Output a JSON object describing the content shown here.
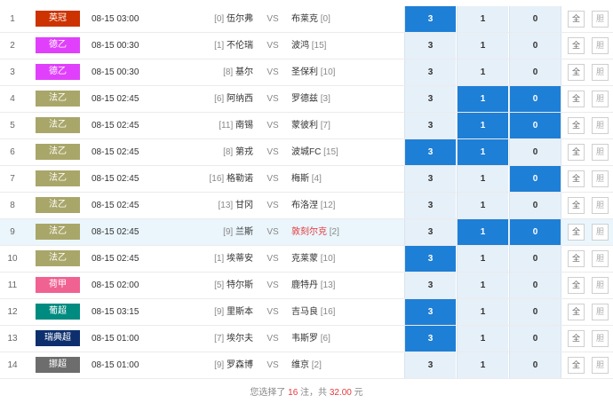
{
  "colors": {
    "selected_odds_bg": "#1e7fd6",
    "unselected_odds_bg": "#e6f0f9",
    "highlight_row_bg": "#eaf6fc",
    "accent_red": "#e4393c"
  },
  "rows": [
    {
      "idx": "1",
      "league": "英冠",
      "league_color": "#cc3300",
      "time": "08-15 03:00",
      "home_rank": "[0]",
      "home": "伍尔弗",
      "vs": "VS",
      "away": "布莱克",
      "away_rank": "[0]",
      "odds": [
        "3",
        "1",
        "0"
      ],
      "sel": [
        true,
        false,
        false
      ],
      "away_red": false,
      "hl": false,
      "all": "全",
      "clear": "胆"
    },
    {
      "idx": "2",
      "league": "德乙",
      "league_color": "#e040fb",
      "time": "08-15 00:30",
      "home_rank": "[1]",
      "home": "不伦瑞",
      "vs": "VS",
      "away": "波鸿",
      "away_rank": "[15]",
      "odds": [
        "3",
        "1",
        "0"
      ],
      "sel": [
        false,
        false,
        false
      ],
      "away_red": false,
      "hl": false,
      "all": "全",
      "clear": "胆"
    },
    {
      "idx": "3",
      "league": "德乙",
      "league_color": "#e040fb",
      "time": "08-15 00:30",
      "home_rank": "[8]",
      "home": "基尔",
      "vs": "VS",
      "away": "圣保利",
      "away_rank": "[10]",
      "odds": [
        "3",
        "1",
        "0"
      ],
      "sel": [
        false,
        false,
        false
      ],
      "away_red": false,
      "hl": false,
      "all": "全",
      "clear": "胆"
    },
    {
      "idx": "4",
      "league": "法乙",
      "league_color": "#a9a66a",
      "time": "08-15 02:45",
      "home_rank": "[6]",
      "home": "阿纳西",
      "vs": "VS",
      "away": "罗德兹",
      "away_rank": "[3]",
      "odds": [
        "3",
        "1",
        "0"
      ],
      "sel": [
        false,
        true,
        true
      ],
      "away_red": false,
      "hl": false,
      "all": "全",
      "clear": "胆"
    },
    {
      "idx": "5",
      "league": "法乙",
      "league_color": "#a9a66a",
      "time": "08-15 02:45",
      "home_rank": "[11]",
      "home": "南锡",
      "vs": "VS",
      "away": "蒙彼利",
      "away_rank": "[7]",
      "odds": [
        "3",
        "1",
        "0"
      ],
      "sel": [
        false,
        true,
        true
      ],
      "away_red": false,
      "hl": false,
      "all": "全",
      "clear": "胆"
    },
    {
      "idx": "6",
      "league": "法乙",
      "league_color": "#a9a66a",
      "time": "08-15 02:45",
      "home_rank": "[8]",
      "home": "第戎",
      "vs": "VS",
      "away": "波城FC",
      "away_rank": "[15]",
      "odds": [
        "3",
        "1",
        "0"
      ],
      "sel": [
        true,
        true,
        false
      ],
      "away_red": false,
      "hl": false,
      "all": "全",
      "clear": "胆"
    },
    {
      "idx": "7",
      "league": "法乙",
      "league_color": "#a9a66a",
      "time": "08-15 02:45",
      "home_rank": "[16]",
      "home": "格勒诺",
      "vs": "VS",
      "away": "梅斯",
      "away_rank": "[4]",
      "odds": [
        "3",
        "1",
        "0"
      ],
      "sel": [
        false,
        false,
        true
      ],
      "away_red": false,
      "hl": false,
      "all": "全",
      "clear": "胆"
    },
    {
      "idx": "8",
      "league": "法乙",
      "league_color": "#a9a66a",
      "time": "08-15 02:45",
      "home_rank": "[13]",
      "home": "甘冈",
      "vs": "VS",
      "away": "布洛涅",
      "away_rank": "[12]",
      "odds": [
        "3",
        "1",
        "0"
      ],
      "sel": [
        false,
        false,
        false
      ],
      "away_red": false,
      "hl": false,
      "all": "全",
      "clear": "胆"
    },
    {
      "idx": "9",
      "league": "法乙",
      "league_color": "#a9a66a",
      "time": "08-15 02:45",
      "home_rank": "[9]",
      "home": "兰斯",
      "vs": "VS",
      "away": "敦刻尔克",
      "away_rank": "[2]",
      "odds": [
        "3",
        "1",
        "0"
      ],
      "sel": [
        false,
        true,
        true
      ],
      "away_red": true,
      "hl": true,
      "all": "全",
      "clear": "胆"
    },
    {
      "idx": "10",
      "league": "法乙",
      "league_color": "#a9a66a",
      "time": "08-15 02:45",
      "home_rank": "[1]",
      "home": "埃蒂安",
      "vs": "VS",
      "away": "克莱蒙",
      "away_rank": "[10]",
      "odds": [
        "3",
        "1",
        "0"
      ],
      "sel": [
        true,
        false,
        false
      ],
      "away_red": false,
      "hl": false,
      "all": "全",
      "clear": "胆"
    },
    {
      "idx": "11",
      "league": "荷甲",
      "league_color": "#f06292",
      "time": "08-15 02:00",
      "home_rank": "[5]",
      "home": "特尔斯",
      "vs": "VS",
      "away": "鹿特丹",
      "away_rank": "[13]",
      "odds": [
        "3",
        "1",
        "0"
      ],
      "sel": [
        false,
        false,
        false
      ],
      "away_red": false,
      "hl": false,
      "all": "全",
      "clear": "胆"
    },
    {
      "idx": "12",
      "league": "葡超",
      "league_color": "#008b80",
      "time": "08-15 03:15",
      "home_rank": "[9]",
      "home": "里斯本",
      "vs": "VS",
      "away": "吉马良",
      "away_rank": "[16]",
      "odds": [
        "3",
        "1",
        "0"
      ],
      "sel": [
        true,
        false,
        false
      ],
      "away_red": false,
      "hl": false,
      "all": "全",
      "clear": "胆"
    },
    {
      "idx": "13",
      "league": "瑞典超",
      "league_color": "#0d2f6e",
      "time": "08-15 01:00",
      "home_rank": "[7]",
      "home": "埃尔夫",
      "vs": "VS",
      "away": "韦斯罗",
      "away_rank": "[6]",
      "odds": [
        "3",
        "1",
        "0"
      ],
      "sel": [
        true,
        false,
        false
      ],
      "away_red": false,
      "hl": false,
      "all": "全",
      "clear": "胆"
    },
    {
      "idx": "14",
      "league": "挪超",
      "league_color": "#6d6d6d",
      "time": "08-15 01:00",
      "home_rank": "[9]",
      "home": "罗森博",
      "vs": "VS",
      "away": "维京",
      "away_rank": "[2]",
      "odds": [
        "3",
        "1",
        "0"
      ],
      "sel": [
        false,
        false,
        false
      ],
      "away_red": false,
      "hl": false,
      "all": "全",
      "clear": "胆"
    }
  ],
  "summary": {
    "prefix": "您选择了",
    "count": "16",
    "mid": "注，共",
    "amount": "32.00",
    "suffix": "元"
  }
}
